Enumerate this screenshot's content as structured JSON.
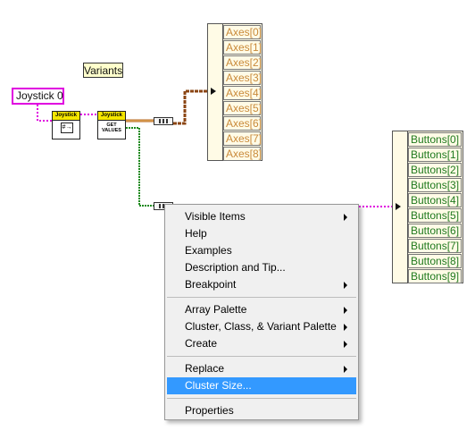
{
  "comment": {
    "text": "Variants"
  },
  "control": {
    "label": "Joystick 0"
  },
  "subvis": [
    {
      "band": "Joystick",
      "body": "#→"
    },
    {
      "band": "Joystick",
      "line1": "GET",
      "line2": "VALUES"
    }
  ],
  "axes": {
    "cells": [
      "Axes[0]",
      "Axes[1]",
      "Axes[2]",
      "Axes[3]",
      "Axes[4]",
      "Axes[5]",
      "Axes[6]",
      "Axes[7]",
      "Axes[8]"
    ],
    "text_color": "#c98a3a"
  },
  "buttons": {
    "cells": [
      "Buttons[0]",
      "Buttons[1]",
      "Buttons[2]",
      "Buttons[3]",
      "Buttons[4]",
      "Buttons[5]",
      "Buttons[6]",
      "Buttons[7]",
      "Buttons[8]",
      "Buttons[9]"
    ],
    "text_color": "#1f7a1f"
  },
  "wire_colors": {
    "refnum": "#e000e0",
    "cluster": "#b5651d",
    "boolean": "#1e8a1e"
  },
  "context_menu": {
    "items": [
      {
        "label": "Visible Items",
        "submenu": true
      },
      {
        "label": "Help",
        "submenu": false
      },
      {
        "label": "Examples",
        "submenu": false
      },
      {
        "label": "Description and Tip...",
        "submenu": false
      },
      {
        "label": "Breakpoint",
        "submenu": true
      },
      {
        "label": "Array Palette",
        "submenu": true
      },
      {
        "label": "Cluster, Class, & Variant Palette",
        "submenu": true
      },
      {
        "label": "Create",
        "submenu": true
      },
      {
        "label": "Replace",
        "submenu": true
      },
      {
        "label": "Cluster Size...",
        "submenu": false,
        "highlighted": true
      },
      {
        "label": "Properties",
        "submenu": false
      }
    ],
    "highlight_color": "#3399ff"
  }
}
